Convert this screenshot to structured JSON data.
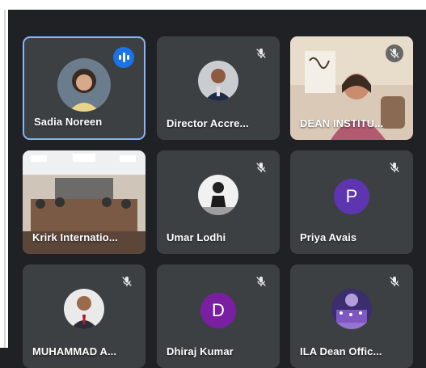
{
  "participants": [
    {
      "name": "Sadia Noreen"
    },
    {
      "name": "Director Accre..."
    },
    {
      "name": "DEAN INSTITU..."
    },
    {
      "name": "Krirk Internatio..."
    },
    {
      "name": "Umar Lodhi"
    },
    {
      "name": "Priya Avais",
      "initial": "P"
    },
    {
      "name": "MUHAMMAD A..."
    },
    {
      "name": "Dhiraj Kumar",
      "initial": "D"
    },
    {
      "name": "ILA Dean Offic..."
    }
  ],
  "colors": {
    "speaking_border": "#8ab4f8",
    "speaking_indicator": "#1a73e8",
    "avatar_p": "#5e35b1",
    "avatar_d": "#7b1fa2"
  },
  "icons": {
    "muted": "mic-off-icon",
    "speaking": "audio-level-icon"
  }
}
